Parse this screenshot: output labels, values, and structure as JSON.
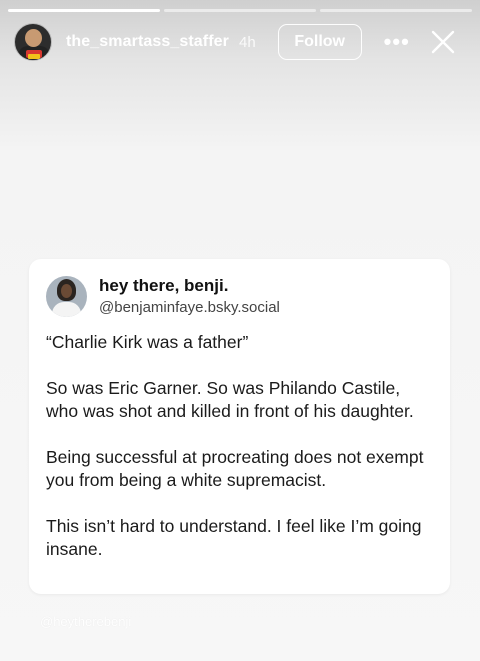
{
  "progress": {
    "segments": 3,
    "active_index": 0
  },
  "header": {
    "username": "the_smartass_staffer",
    "time": "4h",
    "follow_label": "Follow",
    "more_icon": "more-horizontal-icon",
    "close_icon": "close-icon"
  },
  "post": {
    "display_name": "hey there, benji.",
    "handle": "@benjaminfaye.bsky.social",
    "paragraphs": [
      "“Charlie Kirk was a father”",
      "So was Eric Garner. So was Philando Castile, who was shot and killed in front of his daughter.",
      "Being successful at procreating does not exempt you from being a white supremacist.",
      "This isn’t hard to understand. I feel like I’m going insane."
    ]
  },
  "watermark": "@heytherebenji"
}
